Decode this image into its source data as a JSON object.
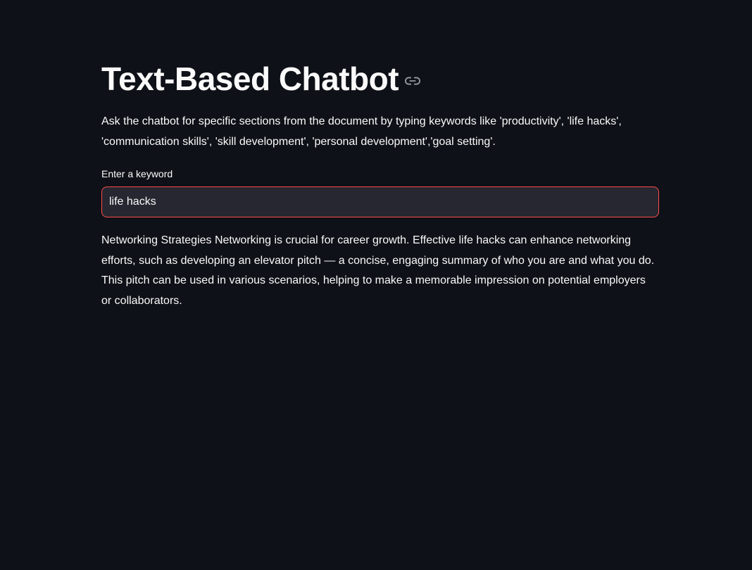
{
  "page": {
    "title": "Text-Based Chatbot",
    "title_anchor_icon": "link-icon",
    "description": "Ask the chatbot for specific sections from the document by typing keywords like 'productivity', 'life hacks', 'communication skills', 'skill development', 'personal development','goal setting'."
  },
  "keyword_input": {
    "label": "Enter a keyword",
    "value": "life hacks",
    "placeholder": ""
  },
  "response": {
    "text": "Networking Strategies Networking is crucial for career growth. Effective life hacks can enhance networking efforts, such as developing an elevator pitch — a concise, engaging summary of who you are and what you do. This pitch can be used in various scenarios, helping to make a memorable impression on potential employers or collaborators."
  },
  "colors": {
    "background": "#0e1117",
    "text": "#fafafa",
    "input_background": "#262730",
    "input_focus_border": "#ff4b4b",
    "icon": "#9a9ca3"
  }
}
